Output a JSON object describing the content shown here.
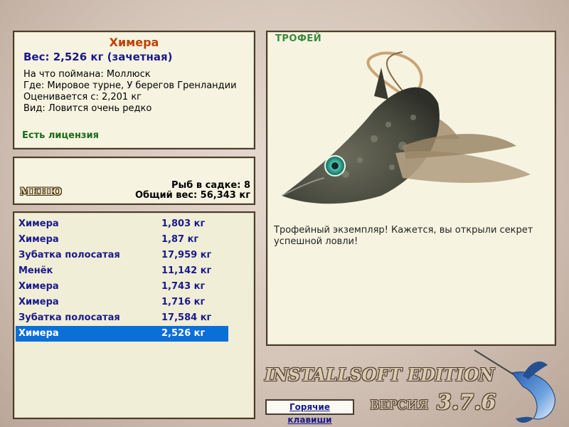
{
  "info": {
    "title": "Химера",
    "weight": "Вес: 2,526 кг (зачетная)",
    "caught_on": "На что поймана: Моллюск",
    "where": "Где: Мировое турне, У берегов Гренландии",
    "valued_from": "Оценивается с: 2,201 кг",
    "kind": "Вид: Ловится очень редко",
    "license": "Есть лицензия"
  },
  "menu": {
    "menu_label": "МЕНЮ",
    "fish_in_keepnet": "Рыб в садке: 8",
    "total_weight": "Общий вес: 56,343 кг"
  },
  "catch_list": [
    {
      "name": "Химера",
      "weight": "1,803 кг"
    },
    {
      "name": "Химера",
      "weight": "1,87 кг"
    },
    {
      "name": "Зубатка полосатая",
      "weight": "17,959 кг"
    },
    {
      "name": "Менёк",
      "weight": "11,142 кг"
    },
    {
      "name": "Химера",
      "weight": "1,743 кг"
    },
    {
      "name": "Химера",
      "weight": "1,716 кг"
    },
    {
      "name": "Зубатка полосатая",
      "weight": "17,584 кг"
    },
    {
      "name": "Химера",
      "weight": "2,526 кг",
      "selected": true
    }
  ],
  "trophy": {
    "label": "ТРОФЕЙ",
    "text": "Трофейный экземпляр! Кажется, вы открыли секрет успешной ловли!"
  },
  "footer": {
    "brand": "INSTALLSOFT EDITION",
    "version_label": "ВЕРСИЯ",
    "version": "3.7.6",
    "hotkeys": "Горячие клавиши"
  },
  "colors": {
    "title": "#c04000",
    "weight": "#1a1a8a",
    "license": "#1b6b1b",
    "selected_row": "#0b6fd8"
  }
}
